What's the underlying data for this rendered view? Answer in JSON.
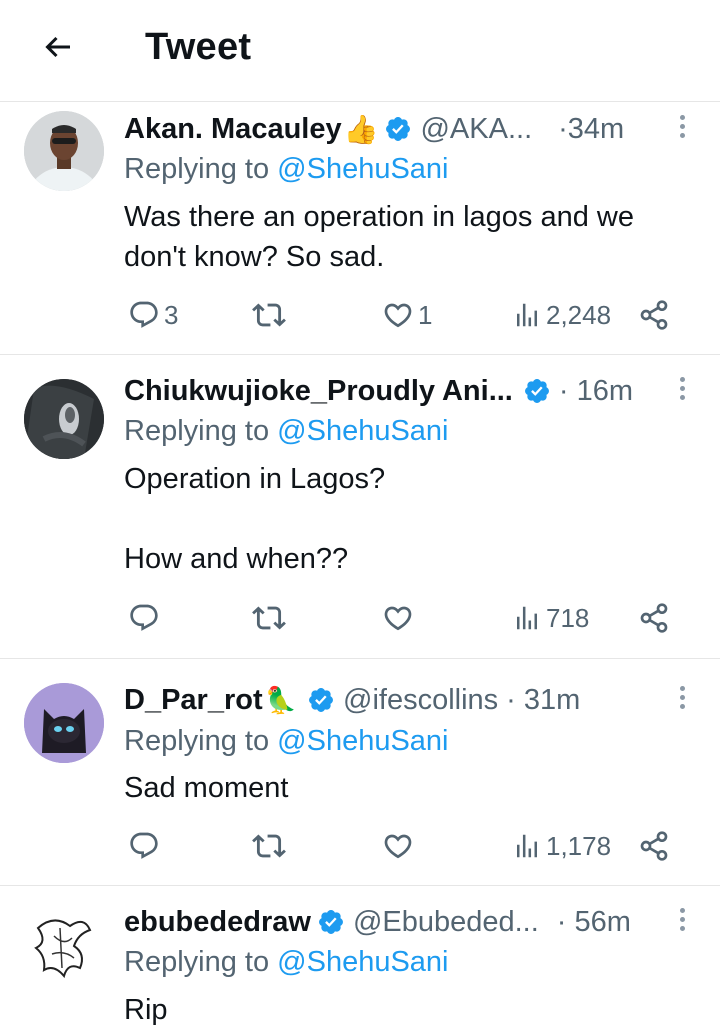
{
  "header": {
    "title": "Tweet"
  },
  "tweets": [
    {
      "name": "Akan. Macauley",
      "emoji": "👍",
      "handle": "@AKA...",
      "time": "·34m",
      "replying_prefix": "Replying to",
      "mention": "@ShehuSani",
      "body": "Was there an operation in lagos and we\ndon't know? So sad.",
      "replies": "3",
      "retweets": "",
      "likes": "1",
      "views": "2,248"
    },
    {
      "name": "Chiukwujioke_Proudly Ani...",
      "emoji": "",
      "handle": "",
      "time": "· 16m",
      "replying_prefix": "Replying to",
      "mention": "@ShehuSani",
      "body": "Operation in Lagos?\n\nHow and when??",
      "replies": "",
      "retweets": "",
      "likes": "",
      "views": "718"
    },
    {
      "name": "D_Par_rot",
      "emoji": "🦜",
      "handle": "@ifescollins",
      "time": "· 31m",
      "replying_prefix": "Replying to",
      "mention": "@ShehuSani",
      "body": "Sad moment",
      "replies": "",
      "retweets": "",
      "likes": "",
      "views": "1,178"
    },
    {
      "name": "ebubededraw",
      "emoji": "",
      "handle": "@Ebubeded...",
      "time": "· 56m",
      "replying_prefix": "Replying to",
      "mention": "@ShehuSani",
      "body": "Rip",
      "replies": "",
      "retweets": "",
      "likes": "",
      "views": ""
    }
  ],
  "colors": {
    "accent": "#1d9bf0",
    "secondary": "#536471",
    "text": "#0f1419"
  }
}
